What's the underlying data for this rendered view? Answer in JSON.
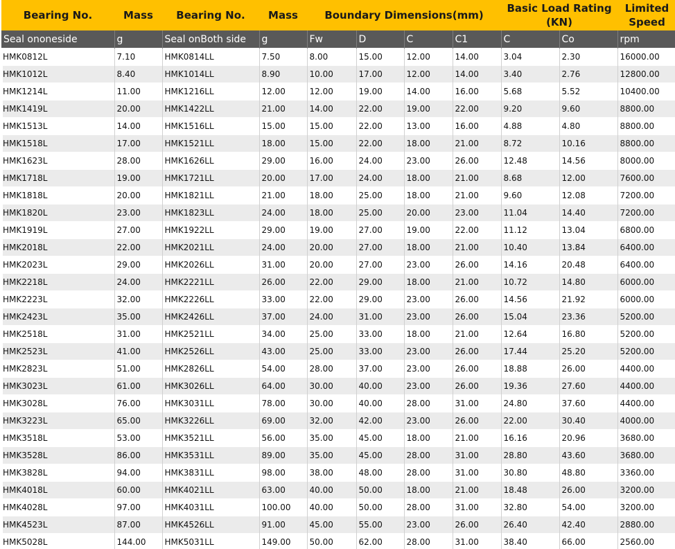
{
  "header_top": {
    "bearing_no_1": "Bearing No.",
    "mass_1": "Mass",
    "bearing_no_2": "Bearing No.",
    "mass_2": "Mass",
    "boundary": "Boundary Dimensions(mm)",
    "basic_load_line1": "Basic Load Rating",
    "basic_load_line2": "(KN)",
    "limited_line1": "Limited",
    "limited_line2": "Speed"
  },
  "header_sub": [
    "Seal ononeside",
    "g",
    "Seal onBoth side",
    "g",
    "Fw",
    "D",
    "C",
    "C1",
    "C",
    "Co",
    "rpm"
  ],
  "rows": [
    [
      "HMK0812L",
      "7.10",
      "HMK0814LL",
      "7.50",
      "8.00",
      "15.00",
      "12.00",
      "14.00",
      "3.04",
      "2.30",
      "16000.00"
    ],
    [
      "HMK1012L",
      "8.40",
      "HMK1014LL",
      "8.90",
      "10.00",
      "17.00",
      "12.00",
      "14.00",
      "3.40",
      "2.76",
      "12800.00"
    ],
    [
      "HMK1214L",
      "11.00",
      "HMK1216LL",
      "12.00",
      "12.00",
      "19.00",
      "14.00",
      "16.00",
      "5.68",
      "5.52",
      "10400.00"
    ],
    [
      "HMK1419L",
      "20.00",
      "HMK1422LL",
      "21.00",
      "14.00",
      "22.00",
      "19.00",
      "22.00",
      "9.20",
      "9.60",
      "8800.00"
    ],
    [
      "HMK1513L",
      "14.00",
      "HMK1516LL",
      "15.00",
      "15.00",
      "22.00",
      "13.00",
      "16.00",
      "4.88",
      "4.80",
      "8800.00"
    ],
    [
      "HMK1518L",
      "17.00",
      "HMK1521LL",
      "18.00",
      "15.00",
      "22.00",
      "18.00",
      "21.00",
      "8.72",
      "10.16",
      "8800.00"
    ],
    [
      "HMK1623L",
      "28.00",
      "HMK1626LL",
      "29.00",
      "16.00",
      "24.00",
      "23.00",
      "26.00",
      "12.48",
      "14.56",
      "8000.00"
    ],
    [
      "HMK1718L",
      "19.00",
      "HMK1721LL",
      "20.00",
      "17.00",
      "24.00",
      "18.00",
      "21.00",
      "8.68",
      "12.00",
      "7600.00"
    ],
    [
      "HMK1818L",
      "20.00",
      "HMK1821LL",
      "21.00",
      "18.00",
      "25.00",
      "18.00",
      "21.00",
      "9.60",
      "12.08",
      "7200.00"
    ],
    [
      "HMK1820L",
      "23.00",
      "HMK1823LL",
      "24.00",
      "18.00",
      "25.00",
      "20.00",
      "23.00",
      "11.04",
      "14.40",
      "7200.00"
    ],
    [
      "HMK1919L",
      "27.00",
      "HMK1922LL",
      "29.00",
      "19.00",
      "27.00",
      "19.00",
      "22.00",
      "11.12",
      "13.04",
      "6800.00"
    ],
    [
      "HMK2018L",
      "22.00",
      "HMK2021LL",
      "24.00",
      "20.00",
      "27.00",
      "18.00",
      "21.00",
      "10.40",
      "13.84",
      "6400.00"
    ],
    [
      "HMK2023L",
      "29.00",
      "HMK2026LL",
      "31.00",
      "20.00",
      "27.00",
      "23.00",
      "26.00",
      "14.16",
      "20.48",
      "6400.00"
    ],
    [
      "HMK2218L",
      "24.00",
      "HMK2221LL",
      "26.00",
      "22.00",
      "29.00",
      "18.00",
      "21.00",
      "10.72",
      "14.80",
      "6000.00"
    ],
    [
      "HMK2223L",
      "32.00",
      "HMK2226LL",
      "33.00",
      "22.00",
      "29.00",
      "23.00",
      "26.00",
      "14.56",
      "21.92",
      "6000.00"
    ],
    [
      "HMK2423L",
      "35.00",
      "HMK2426LL",
      "37.00",
      "24.00",
      "31.00",
      "23.00",
      "26.00",
      "15.04",
      "23.36",
      "5200.00"
    ],
    [
      "HMK2518L",
      "31.00",
      "HMK2521LL",
      "34.00",
      "25.00",
      "33.00",
      "18.00",
      "21.00",
      "12.64",
      "16.80",
      "5200.00"
    ],
    [
      "HMK2523L",
      "41.00",
      "HMK2526LL",
      "43.00",
      "25.00",
      "33.00",
      "23.00",
      "26.00",
      "17.44",
      "25.20",
      "5200.00"
    ],
    [
      "HMK2823L",
      "51.00",
      "HMK2826LL",
      "54.00",
      "28.00",
      "37.00",
      "23.00",
      "26.00",
      "18.88",
      "26.00",
      "4400.00"
    ],
    [
      "HMK3023L",
      "61.00",
      "HMK3026LL",
      "64.00",
      "30.00",
      "40.00",
      "23.00",
      "26.00",
      "19.36",
      "27.60",
      "4400.00"
    ],
    [
      "HMK3028L",
      "76.00",
      "HMK3031LL",
      "78.00",
      "30.00",
      "40.00",
      "28.00",
      "31.00",
      "24.80",
      "37.60",
      "4400.00"
    ],
    [
      "HMK3223L",
      "65.00",
      "HMK3226LL",
      "69.00",
      "32.00",
      "42.00",
      "23.00",
      "26.00",
      "22.00",
      "30.40",
      "4000.00"
    ],
    [
      "HMK3518L",
      "53.00",
      "HMK3521LL",
      "56.00",
      "35.00",
      "45.00",
      "18.00",
      "21.00",
      "16.16",
      "20.96",
      "3680.00"
    ],
    [
      "HMK3528L",
      "86.00",
      "HMK3531LL",
      "89.00",
      "35.00",
      "45.00",
      "28.00",
      "31.00",
      "28.80",
      "43.60",
      "3680.00"
    ],
    [
      "HMK3828L",
      "94.00",
      "HMK3831LL",
      "98.00",
      "38.00",
      "48.00",
      "28.00",
      "31.00",
      "30.80",
      "48.80",
      "3360.00"
    ],
    [
      "HMK4018L",
      "60.00",
      "HMK4021LL",
      "63.00",
      "40.00",
      "50.00",
      "18.00",
      "21.00",
      "18.48",
      "26.00",
      "3200.00"
    ],
    [
      "HMK4028L",
      "97.00",
      "HMK4031LL",
      "100.00",
      "40.00",
      "50.00",
      "28.00",
      "31.00",
      "32.80",
      "54.00",
      "3200.00"
    ],
    [
      "HMK4523L",
      "87.00",
      "HMK4526LL",
      "91.00",
      "45.00",
      "55.00",
      "23.00",
      "26.00",
      "26.40",
      "42.40",
      "2880.00"
    ],
    [
      "HMK5028L",
      "144.00",
      "HMK5031LL",
      "149.00",
      "50.00",
      "62.00",
      "28.00",
      "31.00",
      "38.40",
      "66.00",
      "2560.00"
    ]
  ],
  "colors": {
    "header_yellow": "#ffc000",
    "subheader_gray": "#595959",
    "row_alt": "#ebebeb"
  }
}
